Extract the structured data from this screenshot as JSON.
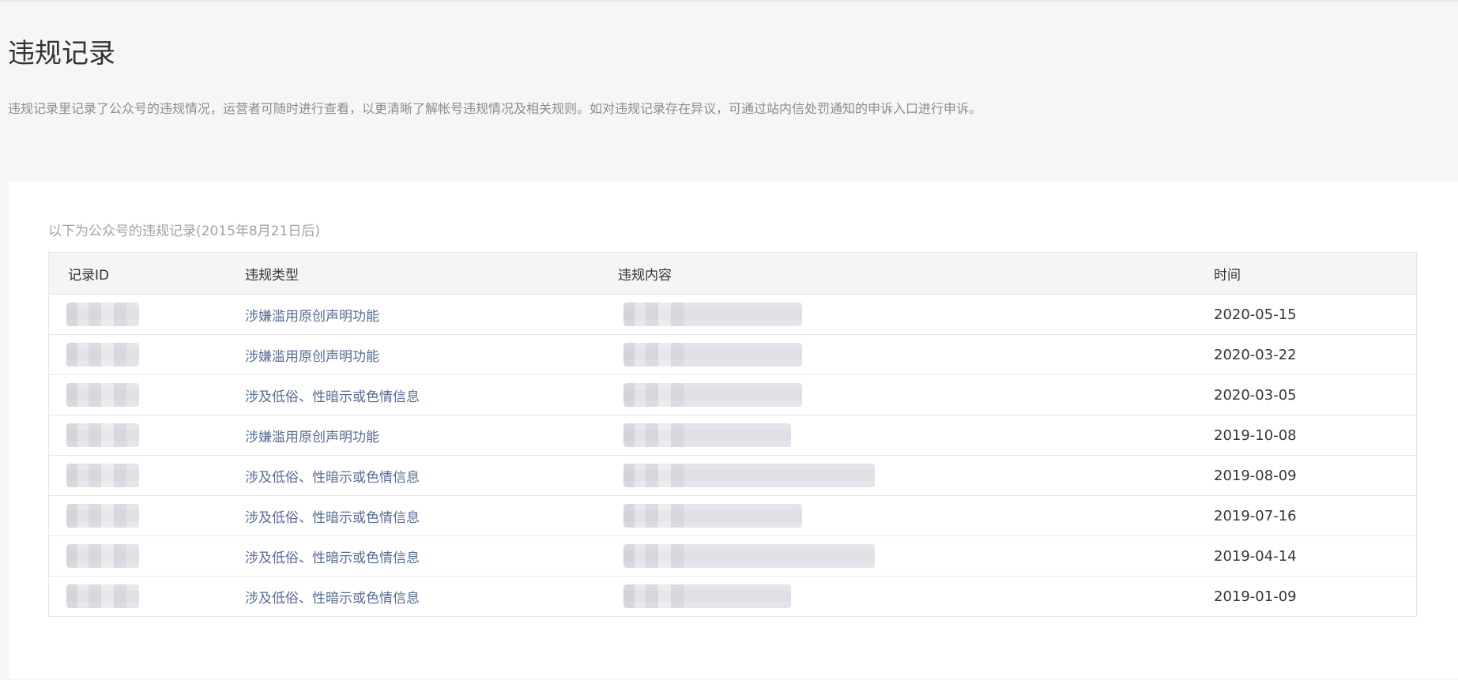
{
  "page": {
    "title": "违规记录",
    "description": "违规记录里记录了公众号的违规情况，运营者可随时进行查看，以更清晰了解帐号违规情况及相关规则。如对违规记录存在异议，可通过站内信处罚通知的申诉入口进行申诉。"
  },
  "records": {
    "caption": "以下为公众号的违规记录(2015年8月21日后)",
    "columns": {
      "id": "记录ID",
      "type": "违规类型",
      "content": "违规内容",
      "time": "时间"
    },
    "rows": [
      {
        "type": "涉嫌滥用原创声明功能",
        "time": "2020-05-15"
      },
      {
        "type": "涉嫌滥用原创声明功能",
        "time": "2020-03-22"
      },
      {
        "type": "涉及低俗、性暗示或色情信息",
        "time": "2020-03-05"
      },
      {
        "type": "涉嫌滥用原创声明功能",
        "time": "2019-10-08"
      },
      {
        "type": "涉及低俗、性暗示或色情信息",
        "time": "2019-08-09"
      },
      {
        "type": "涉及低俗、性暗示或色情信息",
        "time": "2019-07-16"
      },
      {
        "type": "涉及低俗、性暗示或色情信息",
        "time": "2019-04-14"
      },
      {
        "type": "涉及低俗、性暗示或色情信息",
        "time": "2019-01-09"
      }
    ]
  },
  "colors": {
    "link": "#576b95",
    "page_background": "#f5f6f8",
    "table_header_background": "#f4f5f7"
  }
}
